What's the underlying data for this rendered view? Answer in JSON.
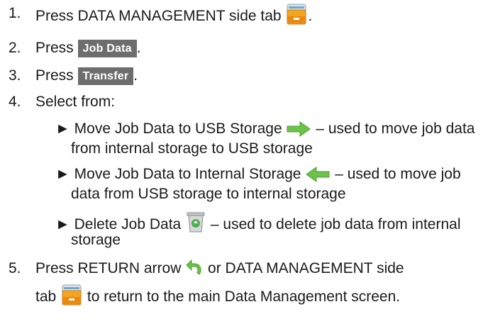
{
  "steps": {
    "s1": {
      "num": "1.",
      "a": "Press DATA MANAGEMENT side tab",
      "b": "."
    },
    "s2": {
      "num": "2.",
      "a": "Press",
      "btn": "Job Data",
      "b": "."
    },
    "s3": {
      "num": "3.",
      "a": "Press",
      "btn": "Transfer",
      "b": "."
    },
    "s4": {
      "num": "4.",
      "a": "Select from:"
    },
    "s5": {
      "num": "5.",
      "a": "Press RETURN arrow",
      "b": "or DATA MANAGEMENT side",
      "c": "tab",
      "d": "to return to the main Data Management screen."
    }
  },
  "options": {
    "o1": {
      "a": "Move Job Data to USB Storage",
      "b": "– used to move job data",
      "c": "from internal storage to USB storage"
    },
    "o2": {
      "a": "Move Job Data to Internal Storage",
      "b": "– used to move job",
      "c": "data from USB storage to internal storage"
    },
    "o3": {
      "a": "Delete Job Data",
      "b": "– used to delete job data from internal",
      "c": "storage"
    }
  },
  "bullet": "►",
  "colors": {
    "button_bg": "#6d6d6d",
    "arrow_green": "#6cc24a",
    "folder_orange": "#f0a020"
  },
  "icons": {
    "folder": "data-management-folder-icon",
    "right": "arrow-right-icon",
    "left": "arrow-left-icon",
    "trash": "recycle-bin-icon",
    "return": "return-arrow-icon"
  }
}
